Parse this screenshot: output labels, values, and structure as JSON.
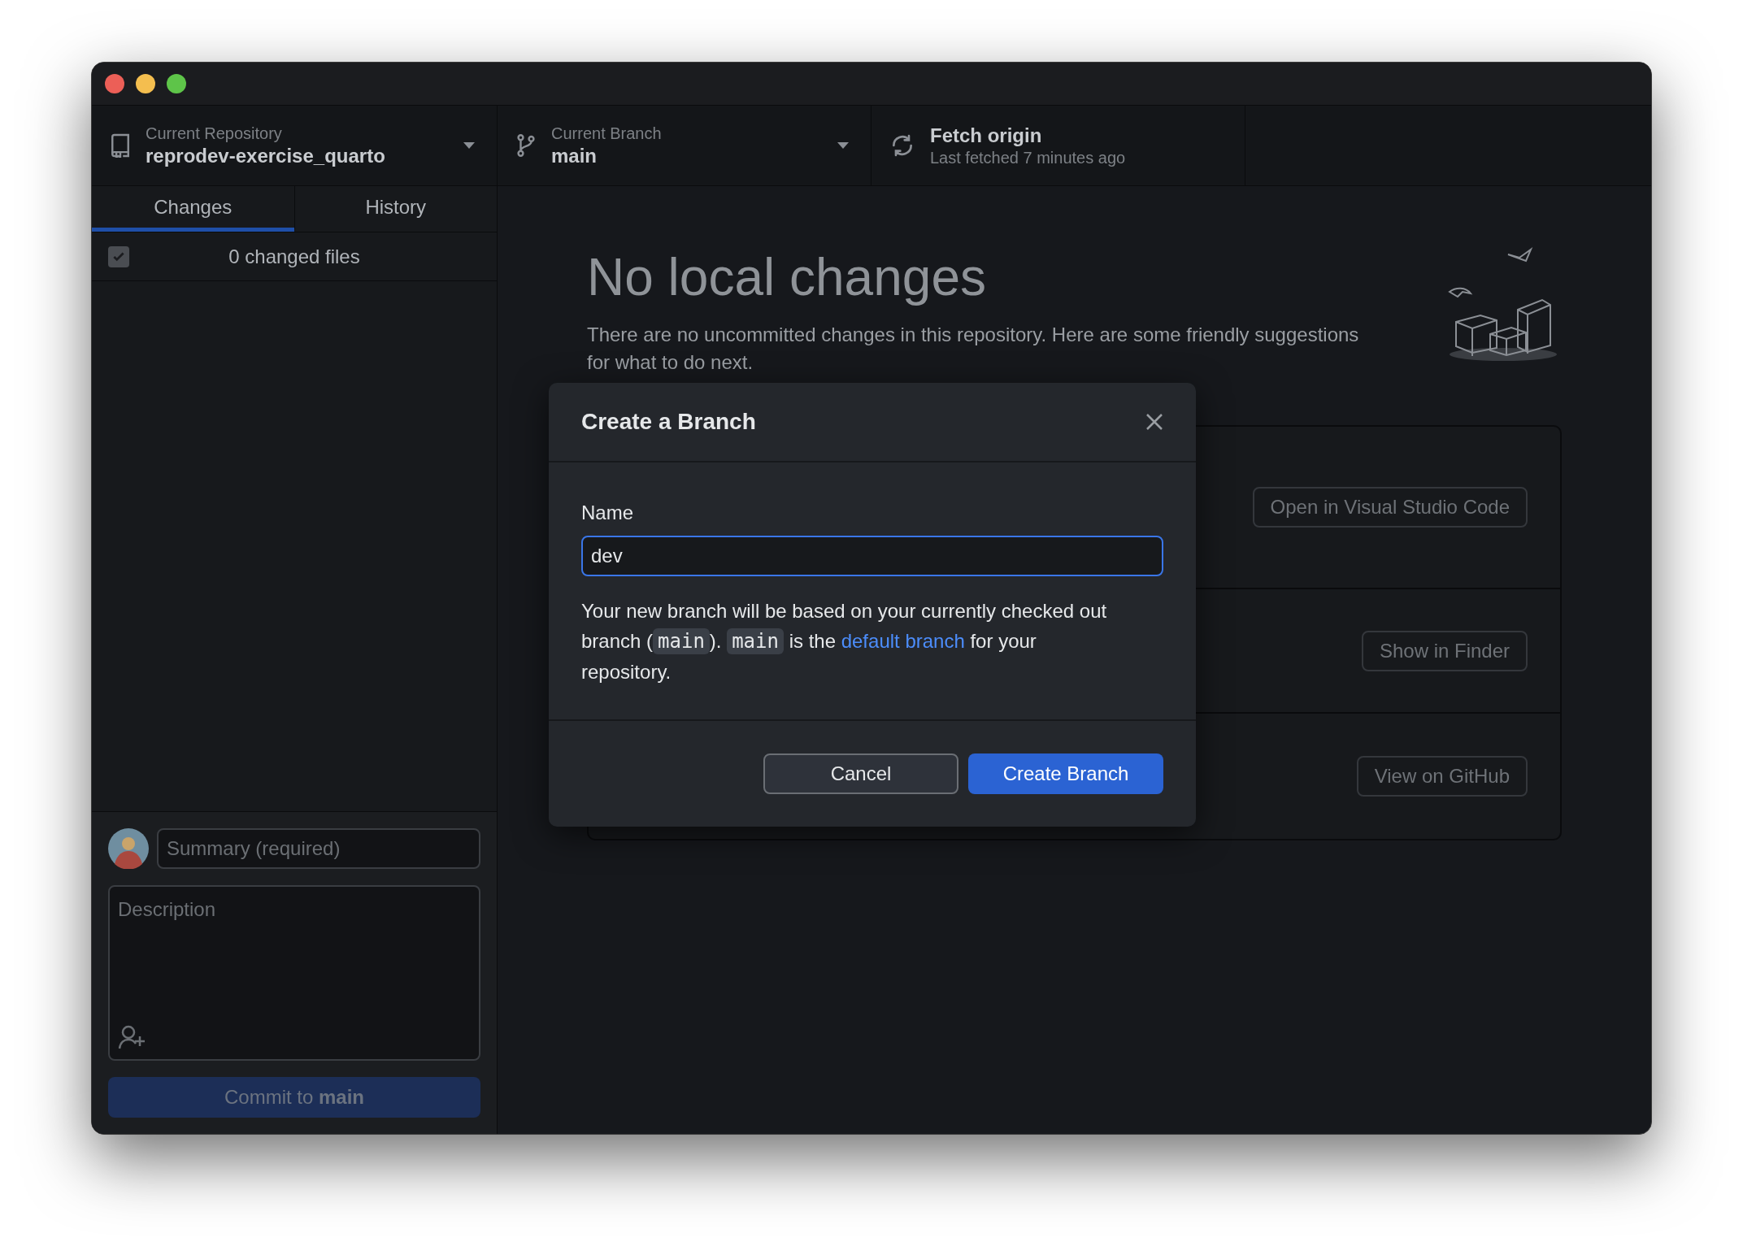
{
  "toolbar": [
    {
      "kind": "repository",
      "label": "Current Repository",
      "value": "reprodev-exercise_quarto"
    },
    {
      "kind": "branch",
      "label": "Current Branch",
      "value": "main"
    },
    {
      "kind": "fetch",
      "label": "Fetch origin",
      "value": "Last fetched 7 minutes ago"
    }
  ],
  "tabs": [
    {
      "label": "Changes",
      "selected": true
    },
    {
      "label": "History",
      "selected": false
    }
  ],
  "changes": {
    "checked": true,
    "count": "0 changed files"
  },
  "commit": {
    "summary_placeholder": "Summary (required)",
    "description_placeholder": "Description",
    "button": "Commit to **main**",
    "disabled": true
  },
  "main": {
    "heading": "No local changes",
    "description": "There are no uncommitted changes in this repository. Here are some friendly suggestions for what to do next.",
    "suggestions": [
      {
        "button": "Open in Visual Studio Code"
      },
      {
        "button": "Show in Finder"
      },
      {
        "button": "View on GitHub"
      }
    ]
  },
  "dialog": {
    "title": "Create a Branch",
    "name_label": "Name",
    "name_value": "dev",
    "note": [
      {
        "kind": "text",
        "text": "Your new branch will be based on your currently checked out branch ("
      },
      {
        "kind": "code",
        "text": "main"
      },
      {
        "kind": "text",
        "text": "). "
      },
      {
        "kind": "code",
        "text": "main"
      },
      {
        "kind": "text",
        "text": " is the "
      },
      {
        "kind": "link",
        "text": "default branch"
      },
      {
        "kind": "text",
        "text": " for your repository."
      }
    ],
    "buttons": [
      {
        "label": "Cancel",
        "kind": "secondary"
      },
      {
        "label": "Create Branch",
        "kind": "primary"
      }
    ]
  }
}
